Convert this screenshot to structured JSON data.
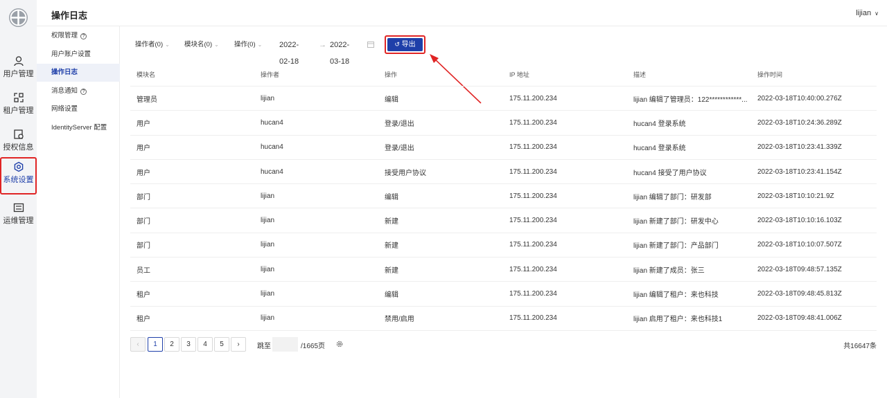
{
  "header": {
    "title": "操作日志",
    "user": "lijian",
    "user_chevron": "∨"
  },
  "rail": [
    {
      "label": "用户管理",
      "icon": "user-icon",
      "active": false
    },
    {
      "label": "租户管理",
      "icon": "tenant-icon",
      "active": false
    },
    {
      "label": "授权信息",
      "icon": "license-icon",
      "active": false
    },
    {
      "label": "系统设置",
      "icon": "settings-icon",
      "active": true
    },
    {
      "label": "运维管理",
      "icon": "ops-icon",
      "active": false
    }
  ],
  "subnav": [
    {
      "label": "权限管理",
      "help": true,
      "active": false
    },
    {
      "label": "用户账户设置",
      "help": false,
      "active": false
    },
    {
      "label": "操作日志",
      "help": false,
      "active": true
    },
    {
      "label": "消息通知",
      "help": true,
      "active": false
    },
    {
      "label": "网络设置",
      "help": false,
      "active": false
    },
    {
      "label": "IdentityServer 配置",
      "help": false,
      "active": false
    }
  ],
  "filters": {
    "operator": "操作者(0)",
    "module": "模块名(0)",
    "action": "操作(0)",
    "date_start": "2022-02-18",
    "date_arrow": "→",
    "date_end": "2022-03-18",
    "export_label": "导出",
    "export_icon": "↺"
  },
  "table": {
    "columns": [
      "模块名",
      "操作者",
      "操作",
      "IP 地址",
      "描述",
      "操作时间"
    ],
    "rows": [
      [
        "管理员",
        "lijian",
        "编辑",
        "175.11.200.234",
        "lijian 编辑了管理员：122************...",
        "2022-03-18T10:40:00.276Z"
      ],
      [
        "用户",
        "hucan4",
        "登录/退出",
        "175.11.200.234",
        "hucan4 登录系统",
        "2022-03-18T10:24:36.289Z"
      ],
      [
        "用户",
        "hucan4",
        "登录/退出",
        "175.11.200.234",
        "hucan4 登录系统",
        "2022-03-18T10:23:41.339Z"
      ],
      [
        "用户",
        "hucan4",
        "接受用户协议",
        "175.11.200.234",
        "hucan4 接受了用户协议",
        "2022-03-18T10:23:41.154Z"
      ],
      [
        "部门",
        "lijian",
        "编辑",
        "175.11.200.234",
        "lijian 编辑了部门：研发部",
        "2022-03-18T10:10:21.9Z"
      ],
      [
        "部门",
        "lijian",
        "新建",
        "175.11.200.234",
        "lijian 新建了部门：研发中心",
        "2022-03-18T10:10:16.103Z"
      ],
      [
        "部门",
        "lijian",
        "新建",
        "175.11.200.234",
        "lijian 新建了部门：产品部门",
        "2022-03-18T10:10:07.507Z"
      ],
      [
        "员工",
        "lijian",
        "新建",
        "175.11.200.234",
        "lijian 新建了成员：张三",
        "2022-03-18T09:48:57.135Z"
      ],
      [
        "租户",
        "lijian",
        "编辑",
        "175.11.200.234",
        "lijian 编辑了租户：来也科技",
        "2022-03-18T09:48:45.813Z"
      ],
      [
        "租户",
        "lijian",
        "禁用/启用",
        "175.11.200.234",
        "lijian 启用了租户：来也科技1",
        "2022-03-18T09:48:41.006Z"
      ]
    ]
  },
  "pagination": {
    "prev": "‹",
    "next": "›",
    "pages": [
      "1",
      "2",
      "3",
      "4",
      "5"
    ],
    "current": "1",
    "jump_label": "跳至",
    "total_pages": "/1665页",
    "total": "共16647条"
  },
  "colors": {
    "accent": "#1e3fa9",
    "highlight": "#e02424"
  }
}
